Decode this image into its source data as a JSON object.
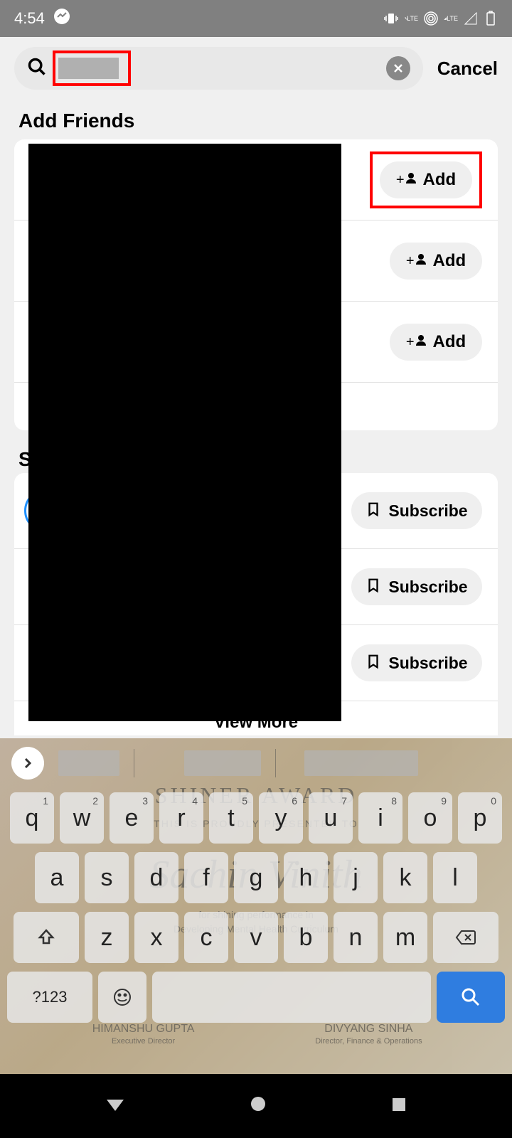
{
  "status": {
    "time": "4:54",
    "lte": "LTE",
    "lte2": "LTE"
  },
  "search": {
    "placeholder": "",
    "cancel": "Cancel"
  },
  "sections": {
    "addFriends": "Add Friends",
    "second": "S",
    "viewMore": "View More"
  },
  "buttons": {
    "add": "Add",
    "subscribe": "Subscribe"
  },
  "friends": [
    {
      "action": "Add"
    },
    {
      "action": "Add"
    },
    {
      "action": "Add"
    },
    {
      "action": ""
    }
  ],
  "subscriptions": [
    {
      "action": "Subscribe"
    },
    {
      "action": "Subscribe"
    },
    {
      "action": "Subscribe"
    }
  ],
  "certificate": {
    "award": "SHINER AWARD",
    "presented": "THIS IS PROUDLY PRESENTED TO",
    "name": "Sachin Vinith",
    "line1": "for shining performance in",
    "line2": "Developing Mental Health Curriculum",
    "signer1": "HIMANSHU GUPTA",
    "title1": "Executive Director",
    "signer2": "DIVYANG SINHA",
    "title2": "Director, Finance & Operations"
  },
  "keyboard": {
    "row1": [
      {
        "k": "q",
        "n": "1"
      },
      {
        "k": "w",
        "n": "2"
      },
      {
        "k": "e",
        "n": "3"
      },
      {
        "k": "r",
        "n": "4"
      },
      {
        "k": "t",
        "n": "5"
      },
      {
        "k": "y",
        "n": "6"
      },
      {
        "k": "u",
        "n": "7"
      },
      {
        "k": "i",
        "n": "8"
      },
      {
        "k": "o",
        "n": "9"
      },
      {
        "k": "p",
        "n": "0"
      }
    ],
    "row2": [
      "a",
      "s",
      "d",
      "f",
      "g",
      "h",
      "j",
      "k",
      "l"
    ],
    "row3": [
      "z",
      "x",
      "c",
      "v",
      "b",
      "n",
      "m"
    ],
    "sym": "?123"
  }
}
